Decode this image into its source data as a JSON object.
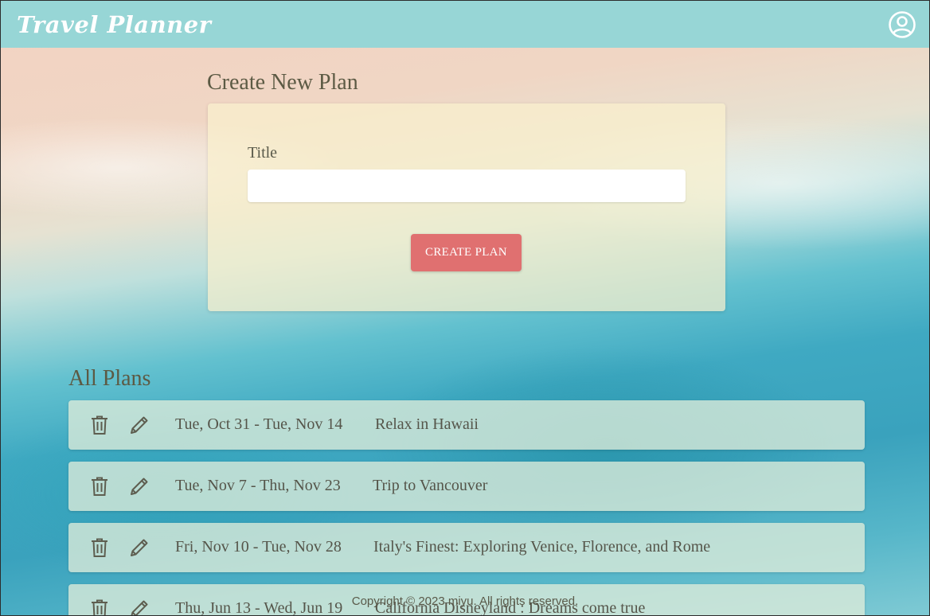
{
  "header": {
    "brand": "Travel Planner",
    "profile_icon": "user-circle-icon"
  },
  "create": {
    "heading": "Create New Plan",
    "title_label": "Title",
    "title_value": "",
    "title_placeholder": "",
    "button_label": "CREATE PLAN"
  },
  "plans": {
    "heading": "All Plans",
    "items": [
      {
        "dates": "Tue, Oct 31 - Tue, Nov 14",
        "name": "Relax in Hawaii"
      },
      {
        "dates": "Tue, Nov 7 - Thu, Nov 23",
        "name": "Trip to Vancouver"
      },
      {
        "dates": "Fri, Nov 10 - Tue, Nov 28",
        "name": "Italy's Finest: Exploring Venice, Florence, and Rome"
      },
      {
        "dates": "Thu, Jun 13 - Wed, Jun 19",
        "name": "California Disneyland : Dreams come true"
      }
    ],
    "row_icons": [
      "trash-icon",
      "pencil-icon"
    ]
  },
  "footer": {
    "copyright": "Copyright © 2023 miyu. All rights reserved."
  },
  "colors": {
    "header_bg": "#97d6d6",
    "button_bg": "#e07070",
    "text": "#5a5a4a"
  }
}
